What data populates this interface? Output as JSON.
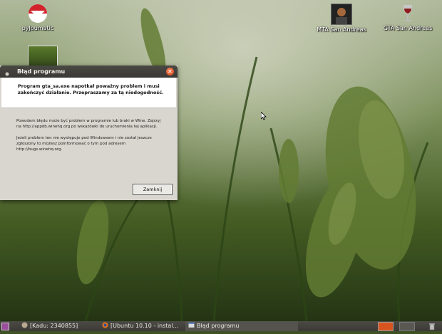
{
  "desktop": {
    "icons": [
      {
        "label": "pyJoumatic"
      },
      {
        "label": "MTA San Andreas"
      },
      {
        "label": "GTA San Andreas"
      }
    ]
  },
  "dialog": {
    "title": "Błąd programu",
    "headline": "Program gta_sa.exe napotkał poważny problem i musi zakończyć działanie. Przepraszamy za tą niedogodność.",
    "body1": "Powodem błędu może być problem w programie lub braki w Wine. Zajrzyj na http://appdb.winehq.org po wskazówki do uruchomienia tej aplikacji.",
    "body2": "Jeżeli problem ten nie występuje pod Windowsem i nie został jeszcze zgłoszony to możesz poinformować o tym pod adresem http://bugs.winehq.org.",
    "close_button": "Zamknij"
  },
  "taskbar": {
    "items": [
      {
        "label": "[Kadu: 2340855]"
      },
      {
        "label": "[Ubuntu 10.10 - instal..."
      },
      {
        "label": "Błąd programu",
        "active": true
      }
    ]
  },
  "colors": {
    "accent": "#d8541f",
    "titlebar": "#3c3b37",
    "dialog_bg": "#d9d6cf",
    "wallpaper": "#4a6628"
  }
}
